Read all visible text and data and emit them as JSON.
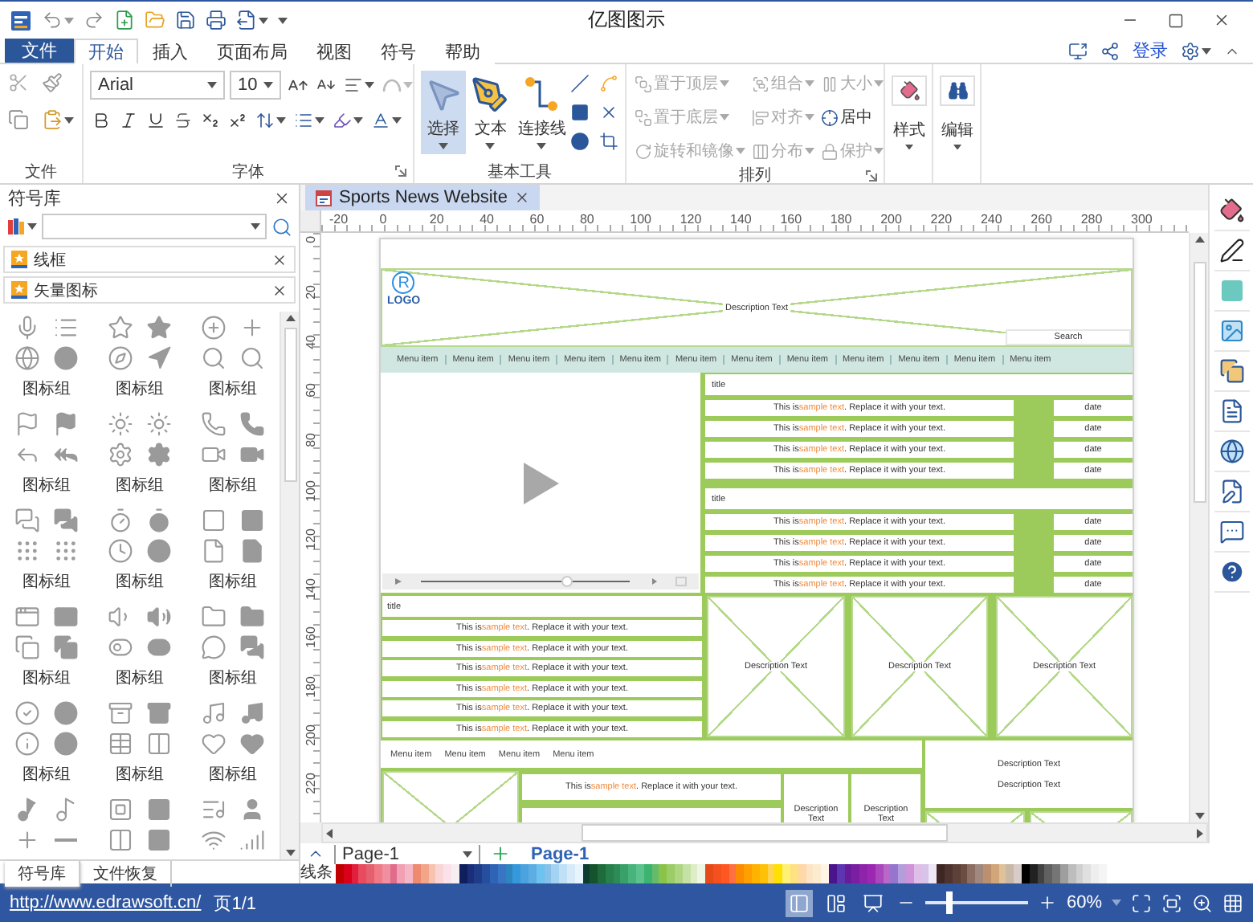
{
  "window": {
    "title": "亿图图示"
  },
  "menu": {
    "file_button": "文件",
    "tabs": [
      {
        "label": "开始",
        "selected": true
      },
      {
        "label": "插入",
        "selected": false
      },
      {
        "label": "页面布局",
        "selected": false
      },
      {
        "label": "视图",
        "selected": false
      },
      {
        "label": "符号",
        "selected": false
      },
      {
        "label": "帮助",
        "selected": false
      }
    ],
    "login": "登录"
  },
  "ribbon": {
    "clipboard": {
      "label": "文件"
    },
    "font": {
      "label": "字体",
      "font_name": "Arial",
      "font_size": "10"
    },
    "tools": {
      "label": "基本工具",
      "buttons": [
        {
          "label": "选择",
          "selected": true
        },
        {
          "label": "文本",
          "selected": false
        },
        {
          "label": "连接线",
          "selected": false
        }
      ]
    },
    "arrange": {
      "label": "排列",
      "items": [
        {
          "label": "置于顶层",
          "dropdown": true,
          "disabled": true
        },
        {
          "label": "置于底层",
          "dropdown": true,
          "disabled": true
        },
        {
          "label": "旋转和镜像",
          "dropdown": true,
          "disabled": true
        },
        {
          "label": "组合",
          "dropdown": true,
          "disabled": true
        },
        {
          "label": "对齐",
          "dropdown": true,
          "disabled": true
        },
        {
          "label": "分布",
          "dropdown": true,
          "disabled": true
        },
        {
          "label": "大小",
          "dropdown": true,
          "disabled": true
        },
        {
          "label": "居中",
          "dropdown": false,
          "disabled": false
        },
        {
          "label": "保护",
          "dropdown": true,
          "disabled": true
        }
      ]
    },
    "style": {
      "label": "样式"
    },
    "edit": {
      "label": "编辑"
    }
  },
  "symbol_panel": {
    "title": "符号库",
    "sections": [
      {
        "title": "线框"
      },
      {
        "title": "矢量图标"
      }
    ],
    "groups": [
      {
        "kind": "full",
        "label": "图标组"
      },
      {
        "kind": "full",
        "label": "图标组"
      },
      {
        "kind": "full",
        "label": "图标组"
      },
      {
        "kind": "full",
        "label": "图标组"
      },
      {
        "kind": "full",
        "label": "图标组"
      },
      {
        "kind": "full",
        "label": "图标组"
      },
      {
        "kind": "full",
        "label": "图标组"
      },
      {
        "kind": "full",
        "label": "图标组"
      },
      {
        "kind": "full",
        "label": "图标组"
      },
      {
        "kind": "full",
        "label": "图标组"
      },
      {
        "kind": "full",
        "label": "图标组"
      },
      {
        "kind": "full",
        "label": "图标组"
      },
      {
        "kind": "full",
        "label": "图标组"
      },
      {
        "kind": "full",
        "label": "图标组"
      },
      {
        "kind": "full",
        "label": "图标组"
      },
      {
        "kind": "partial"
      },
      {
        "kind": "partial"
      },
      {
        "kind": "partial"
      }
    ],
    "tabs": [
      {
        "label": "符号库",
        "selected": true
      },
      {
        "label": "文件恢复",
        "selected": false
      }
    ]
  },
  "document_tab": {
    "title": "Sports News Website"
  },
  "rulers": {
    "horizontal": [
      "-20",
      "0",
      "20",
      "40",
      "60",
      "80",
      "100",
      "120",
      "140",
      "160",
      "180",
      "200",
      "220",
      "240",
      "260",
      "280",
      "300"
    ],
    "vertical": [
      "0",
      "20",
      "40",
      "60",
      "80",
      "100",
      "120",
      "140",
      "160",
      "180",
      "200",
      "220"
    ]
  },
  "wireframe": {
    "logo": {
      "mark": "R",
      "text": "LOGO"
    },
    "header_text": "Description Text",
    "search": "Search",
    "nav": [
      "Menu item",
      "Menu item",
      "Menu item",
      "Menu item",
      "Menu item",
      "Menu item",
      "Menu item",
      "Menu item",
      "Menu item",
      "Menu item",
      "Menu item",
      "Menu item"
    ],
    "news": [
      {
        "title": "title",
        "rows": [
          {
            "text": {
              "pre": "This is ",
              "accent": "sample text",
              "post": ". Replace it with your text."
            },
            "date": "date"
          },
          {
            "text": {
              "pre": "This is ",
              "accent": "sample text",
              "post": ". Replace it with your text."
            },
            "date": "date"
          },
          {
            "text": {
              "pre": "This is ",
              "accent": "sample text",
              "post": ". Replace it with your text."
            },
            "date": "date"
          },
          {
            "text": {
              "pre": "This is ",
              "accent": "sample text",
              "post": ". Replace it with your text."
            },
            "date": "date"
          }
        ]
      },
      {
        "title": "title",
        "rows": [
          {
            "text": {
              "pre": "This is ",
              "accent": "sample text",
              "post": ". Replace it with your text."
            },
            "date": "date"
          },
          {
            "text": {
              "pre": "This is ",
              "accent": "sample text",
              "post": ". Replace it with your text."
            },
            "date": "date"
          },
          {
            "text": {
              "pre": "This is ",
              "accent": "sample text",
              "post": ". Replace it with your text."
            },
            "date": "date"
          },
          {
            "text": {
              "pre": "This is ",
              "accent": "sample text",
              "post": ". Replace it with your text."
            },
            "date": "date"
          }
        ]
      }
    ],
    "list": {
      "title": "title",
      "rows": [
        {
          "pre": "This is ",
          "accent": "sample text",
          "post": ". Replace it with your text."
        },
        {
          "pre": "This is ",
          "accent": "sample text",
          "post": ". Replace it with your text."
        },
        {
          "pre": "This is ",
          "accent": "sample text",
          "post": ". Replace it with your text."
        },
        {
          "pre": "This is ",
          "accent": "sample text",
          "post": ". Replace it with your text."
        },
        {
          "pre": "This is ",
          "accent": "sample text",
          "post": ". Replace it with your text."
        },
        {
          "pre": "This is ",
          "accent": "sample text",
          "post": ". Replace it with your text."
        }
      ]
    },
    "cards": [
      "Description Text",
      "Description Text",
      "Description Text"
    ],
    "footer_nav": [
      "Menu item",
      "Menu item",
      "Menu item",
      "Menu item"
    ],
    "footer_row": {
      "pre": "This is ",
      "accent": "sample text",
      "post": ". Replace it with your text."
    },
    "footer_cards": [
      "Description Text",
      "Description Text"
    ],
    "footer_box": [
      "Description Text",
      "Description Text"
    ]
  },
  "page_bar": {
    "page_select": "Page-1",
    "pages": [
      {
        "label": "Page-1",
        "selected": true
      }
    ]
  },
  "palette": {
    "label": "线条",
    "colors": [
      {
        "color": "#c00000"
      },
      {
        "color": "#d9001b"
      },
      {
        "color": "#e0203c"
      },
      {
        "color": "#e84a5f"
      },
      {
        "color": "#e5606e"
      },
      {
        "color": "#ef7a86"
      },
      {
        "color": "#f08fa0"
      },
      {
        "color": "#e06b8a"
      },
      {
        "color": "#f2a0b3"
      },
      {
        "color": "#f5b7c5"
      },
      {
        "color": "#ee8a6e"
      },
      {
        "color": "#f3a58a"
      },
      {
        "color": "#f7c3b0"
      },
      {
        "color": "#f9d5d5"
      },
      {
        "color": "#fbe2ea"
      },
      {
        "color": "#f7eef2"
      },
      {
        "color": "#0e1f5b"
      },
      {
        "color": "#1a2e7a"
      },
      {
        "color": "#1f3c88"
      },
      {
        "color": "#254f9e"
      },
      {
        "color": "#2f63b5"
      },
      {
        "color": "#3a75c4"
      },
      {
        "color": "#2e86c1"
      },
      {
        "color": "#3498db"
      },
      {
        "color": "#4aa3df"
      },
      {
        "color": "#5dade2"
      },
      {
        "color": "#6cc3f0"
      },
      {
        "color": "#85c1e9"
      },
      {
        "color": "#a3d3f0"
      },
      {
        "color": "#bfe0f5"
      },
      {
        "color": "#d6eaf8"
      },
      {
        "color": "#e8f4fb"
      },
      {
        "color": "#0b3d2e"
      },
      {
        "color": "#14532d"
      },
      {
        "color": "#1e6b3c"
      },
      {
        "color": "#27804a"
      },
      {
        "color": "#2e8b57"
      },
      {
        "color": "#38a169"
      },
      {
        "color": "#48b37a"
      },
      {
        "color": "#5cc28e"
      },
      {
        "color": "#3cb371"
      },
      {
        "color": "#66bb6a"
      },
      {
        "color": "#8bc34a"
      },
      {
        "color": "#9ccc65"
      },
      {
        "color": "#aed581"
      },
      {
        "color": "#c5e1a5"
      },
      {
        "color": "#dcedc8"
      },
      {
        "color": "#eef6e4"
      },
      {
        "color": "#e64a19"
      },
      {
        "color": "#f4511e"
      },
      {
        "color": "#ff5722"
      },
      {
        "color": "#ff7043"
      },
      {
        "color": "#fb8c00"
      },
      {
        "color": "#ffa000"
      },
      {
        "color": "#ffb300"
      },
      {
        "color": "#ffc107"
      },
      {
        "color": "#ffd54f"
      },
      {
        "color": "#ffe000"
      },
      {
        "color": "#fff176"
      },
      {
        "color": "#ffe082"
      },
      {
        "color": "#ffd8a8"
      },
      {
        "color": "#fce4c4"
      },
      {
        "color": "#fdebd0"
      },
      {
        "color": "#fef5e7"
      },
      {
        "color": "#4a148c"
      },
      {
        "color": "#5e35b1"
      },
      {
        "color": "#6a1b9a"
      },
      {
        "color": "#7b1fa2"
      },
      {
        "color": "#8e24aa"
      },
      {
        "color": "#9c27b0"
      },
      {
        "color": "#ab47bc"
      },
      {
        "color": "#ba68c8"
      },
      {
        "color": "#9575cd"
      },
      {
        "color": "#b39ddb"
      },
      {
        "color": "#ce93d8"
      },
      {
        "color": "#e1bee7"
      },
      {
        "color": "#d7c4e8"
      },
      {
        "color": "#ede7f6"
      },
      {
        "color": "#3e2723"
      },
      {
        "color": "#4e342e"
      },
      {
        "color": "#5d4037"
      },
      {
        "color": "#6d4c41"
      },
      {
        "color": "#8d6e63"
      },
      {
        "color": "#a1887f"
      },
      {
        "color": "#bc8f6f"
      },
      {
        "color": "#d2a679"
      },
      {
        "color": "#e0c29a"
      },
      {
        "color": "#c8b9a6"
      },
      {
        "color": "#d7ccc8"
      },
      {
        "color": "#000000"
      },
      {
        "color": "#212121"
      },
      {
        "color": "#424242"
      },
      {
        "color": "#616161"
      },
      {
        "color": "#757575"
      },
      {
        "color": "#9e9e9e"
      },
      {
        "color": "#bdbdbd"
      },
      {
        "color": "#d0d0d0"
      },
      {
        "color": "#e0e0e0"
      },
      {
        "color": "#eeeeee"
      },
      {
        "color": "#f5f5f5"
      }
    ]
  },
  "status_bar": {
    "link": "http://www.edrawsoft.cn/",
    "page": "页1/1",
    "zoom": {
      "level": 0.2,
      "reading": "60%"
    }
  }
}
